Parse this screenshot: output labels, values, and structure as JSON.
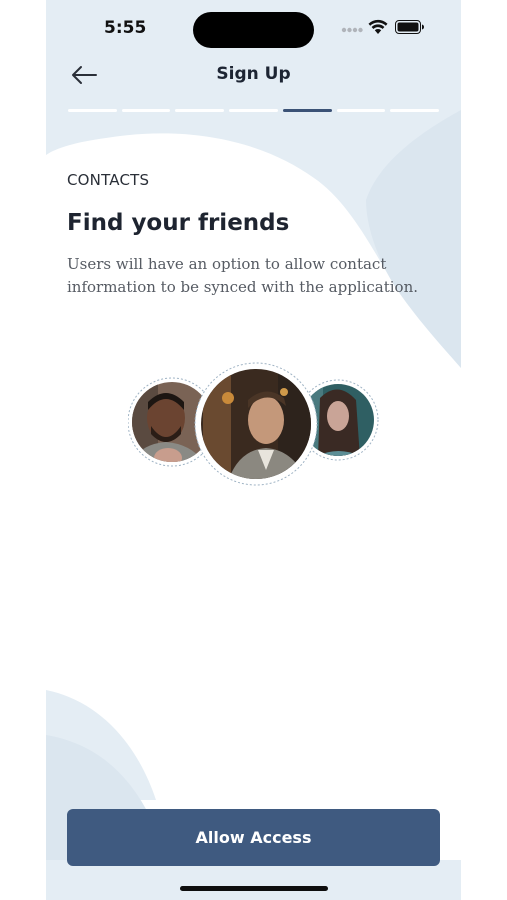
{
  "status_bar": {
    "time": "5:55"
  },
  "nav": {
    "title": "Sign Up",
    "back_icon": "arrow-left-icon"
  },
  "progress": {
    "total_steps": 7,
    "current_step": 5
  },
  "content": {
    "section_label": "CONTACTS",
    "title": "Find your friends",
    "description": "Users will have an option to allow contact information to be synced with the application."
  },
  "avatars": [
    {
      "name": "contact-avatar-1"
    },
    {
      "name": "contact-avatar-2"
    },
    {
      "name": "contact-avatar-3"
    }
  ],
  "actions": {
    "allow_access_label": "Allow Access"
  },
  "colors": {
    "accent": "#3f5a80",
    "progress_active": "#3b5276",
    "background_shape": "#e4edf4"
  }
}
